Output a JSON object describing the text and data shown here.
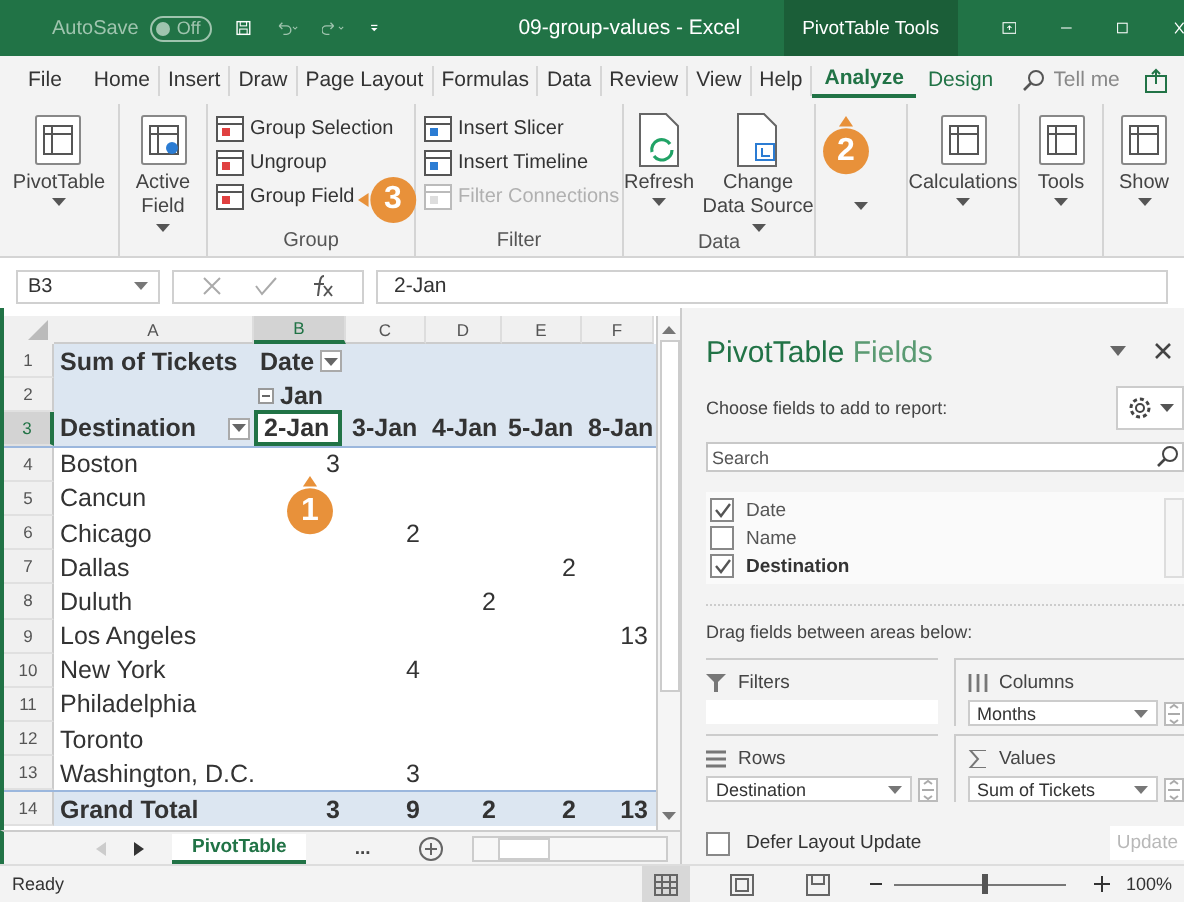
{
  "title_bar": {
    "autosave_label": "AutoSave",
    "autosave_on": false,
    "autosave_state": "Off",
    "document_title": "09-group-values  -  Excel",
    "context_label": "PivotTable Tools"
  },
  "ribbon_tabs": [
    {
      "label": "File",
      "selected": false,
      "kind": "normal"
    },
    {
      "label": "Home",
      "selected": false,
      "kind": "normal"
    },
    {
      "label": "Insert",
      "selected": false,
      "kind": "normal"
    },
    {
      "label": "Draw",
      "selected": false,
      "kind": "normal"
    },
    {
      "label": "Page Layout",
      "selected": false,
      "kind": "normal"
    },
    {
      "label": "Formulas",
      "selected": false,
      "kind": "normal"
    },
    {
      "label": "Data",
      "selected": false,
      "kind": "normal"
    },
    {
      "label": "Review",
      "selected": false,
      "kind": "normal"
    },
    {
      "label": "View",
      "selected": false,
      "kind": "normal"
    },
    {
      "label": "Help",
      "selected": false,
      "kind": "normal"
    },
    {
      "label": "Analyze",
      "selected": true,
      "kind": "context"
    },
    {
      "label": "Design",
      "selected": false,
      "kind": "context"
    }
  ],
  "tell_me": {
    "placeholder": "Tell me"
  },
  "ribbon_groups": [
    {
      "items": [
        {
          "kind": "large",
          "label": "PivotTable",
          "dropdown": true
        }
      ]
    },
    {
      "items": [
        {
          "kind": "large",
          "label": "Active Field",
          "dropdown": true
        }
      ]
    },
    {
      "label": "Group",
      "items": [
        {
          "kind": "small",
          "label": "Group Selection",
          "disabled": false
        },
        {
          "kind": "small",
          "label": "Ungroup",
          "disabled": false
        },
        {
          "kind": "small",
          "label": "Group Field",
          "disabled": false
        }
      ]
    },
    {
      "label": "Filter",
      "items": [
        {
          "kind": "small",
          "label": "Insert Slicer",
          "disabled": false
        },
        {
          "kind": "small",
          "label": "Insert Timeline",
          "disabled": false
        },
        {
          "kind": "small",
          "label": "Filter Connections",
          "disabled": true
        }
      ]
    },
    {
      "label": "Data",
      "items": [
        {
          "kind": "large",
          "label": "Refresh",
          "dropdown": true
        },
        {
          "kind": "large",
          "label": "Change Data Source",
          "dropdown": true
        }
      ]
    },
    {
      "items": [
        {
          "kind": "large",
          "dropdown": true
        }
      ]
    },
    {
      "items": [
        {
          "kind": "large",
          "label": "Calculations",
          "dropdown": true
        }
      ]
    },
    {
      "items": [
        {
          "kind": "large",
          "label": "Tools",
          "dropdown": true
        }
      ]
    },
    {
      "items": [
        {
          "kind": "large",
          "label": "Show",
          "dropdown": true
        }
      ]
    }
  ],
  "formula_bar": {
    "name_box": "B3",
    "formula": "2-Jan"
  },
  "sheet": {
    "columns": [
      {
        "label": "A",
        "selected": false
      },
      {
        "label": "B",
        "selected": true
      },
      {
        "label": "C",
        "selected": false
      },
      {
        "label": "D",
        "selected": false
      },
      {
        "label": "E",
        "selected": false
      },
      {
        "label": "F",
        "selected": false
      }
    ],
    "rows": [
      {
        "number": "1",
        "selected": false,
        "kind": "header",
        "cells": [
          {
            "text": "Sum of Tickets"
          },
          {
            "text": "Date",
            "filter_button": true
          },
          null,
          null,
          null,
          null
        ]
      },
      {
        "number": "2",
        "selected": false,
        "kind": "header",
        "cells": [
          null,
          {
            "text": "Jan",
            "collapse_button": true
          },
          null,
          null,
          null,
          null
        ]
      },
      {
        "number": "3",
        "selected": true,
        "kind": "header",
        "cells": [
          {
            "text": "Destination",
            "filter_button": true
          },
          {
            "text": "2-Jan",
            "active": true
          },
          {
            "text": "3-Jan"
          },
          {
            "text": "4-Jan"
          },
          {
            "text": "5-Jan"
          },
          {
            "text": "8-Jan"
          }
        ]
      },
      {
        "number": "4",
        "selected": false,
        "kind": "body",
        "cells": [
          {
            "text": "Boston"
          },
          {
            "text": "3"
          },
          null,
          null,
          null,
          null
        ]
      },
      {
        "number": "5",
        "selected": false,
        "kind": "body",
        "cells": [
          {
            "text": "Cancun"
          },
          null,
          null,
          null,
          null,
          null
        ]
      },
      {
        "number": "6",
        "selected": false,
        "kind": "body",
        "cells": [
          {
            "text": "Chicago"
          },
          null,
          {
            "text": "2"
          },
          null,
          null,
          null
        ]
      },
      {
        "number": "7",
        "selected": false,
        "kind": "body",
        "cells": [
          {
            "text": "Dallas"
          },
          null,
          null,
          null,
          {
            "text": "2"
          },
          null
        ]
      },
      {
        "number": "8",
        "selected": false,
        "kind": "body",
        "cells": [
          {
            "text": "Duluth"
          },
          null,
          null,
          {
            "text": "2"
          },
          null,
          null
        ]
      },
      {
        "number": "9",
        "selected": false,
        "kind": "body",
        "cells": [
          {
            "text": "Los Angeles"
          },
          null,
          null,
          null,
          null,
          {
            "text": "13"
          }
        ]
      },
      {
        "number": "10",
        "selected": false,
        "kind": "body",
        "cells": [
          {
            "text": "New York"
          },
          null,
          {
            "text": "4"
          },
          null,
          null,
          null
        ]
      },
      {
        "number": "11",
        "selected": false,
        "kind": "body",
        "cells": [
          {
            "text": "Philadelphia"
          },
          null,
          null,
          null,
          null,
          null
        ]
      },
      {
        "number": "12",
        "selected": false,
        "kind": "body",
        "cells": [
          {
            "text": "Toronto"
          },
          null,
          null,
          null,
          null,
          null
        ]
      },
      {
        "number": "13",
        "selected": false,
        "kind": "body",
        "cells": [
          {
            "text": "Washington, D.C."
          },
          null,
          {
            "text": "3"
          },
          null,
          null,
          null
        ]
      },
      {
        "number": "14",
        "selected": false,
        "kind": "total",
        "cells": [
          {
            "text": "Grand Total"
          },
          {
            "text": "3"
          },
          {
            "text": "9"
          },
          {
            "text": "2"
          },
          {
            "text": "2"
          },
          {
            "text": "13"
          }
        ]
      }
    ]
  },
  "sheet_tabs": [
    {
      "label": "PivotTable",
      "selected": true
    },
    {
      "label": "...",
      "selected": false
    }
  ],
  "field_pane": {
    "title_main": "PivotTable",
    "title_accent": "Fields",
    "instruction": "Choose fields to add to report:",
    "search": {
      "placeholder": "Search"
    },
    "fields": [
      {
        "label": "Date",
        "checked": true,
        "emphasized": false
      },
      {
        "label": "Name",
        "checked": false,
        "emphasized": false
      },
      {
        "label": "Destination",
        "checked": true,
        "emphasized": true
      }
    ],
    "areas_hint": "Drag fields between areas below:",
    "areas": [
      {
        "label": "Filters",
        "kind": "filters"
      },
      {
        "label": "Columns",
        "kind": "columns",
        "item": "Months"
      },
      {
        "label": "Rows",
        "kind": "rows",
        "item": "Destination"
      },
      {
        "label": "Values",
        "kind": "values",
        "item": "Sum of Tickets"
      }
    ],
    "defer": {
      "label": "Defer Layout Update",
      "checked": false
    },
    "update_button": {
      "label": "Update",
      "disabled": true
    }
  },
  "status_bar": {
    "status": "Ready",
    "views": [
      {
        "selected": true
      },
      {
        "selected": false
      },
      {
        "selected": false
      }
    ],
    "zoom": {
      "level": 0.52,
      "reading": "100%"
    }
  },
  "callouts": [
    {
      "number": "1",
      "kind": "up"
    },
    {
      "number": "2",
      "kind": "up"
    },
    {
      "number": "3",
      "kind": "left"
    }
  ]
}
